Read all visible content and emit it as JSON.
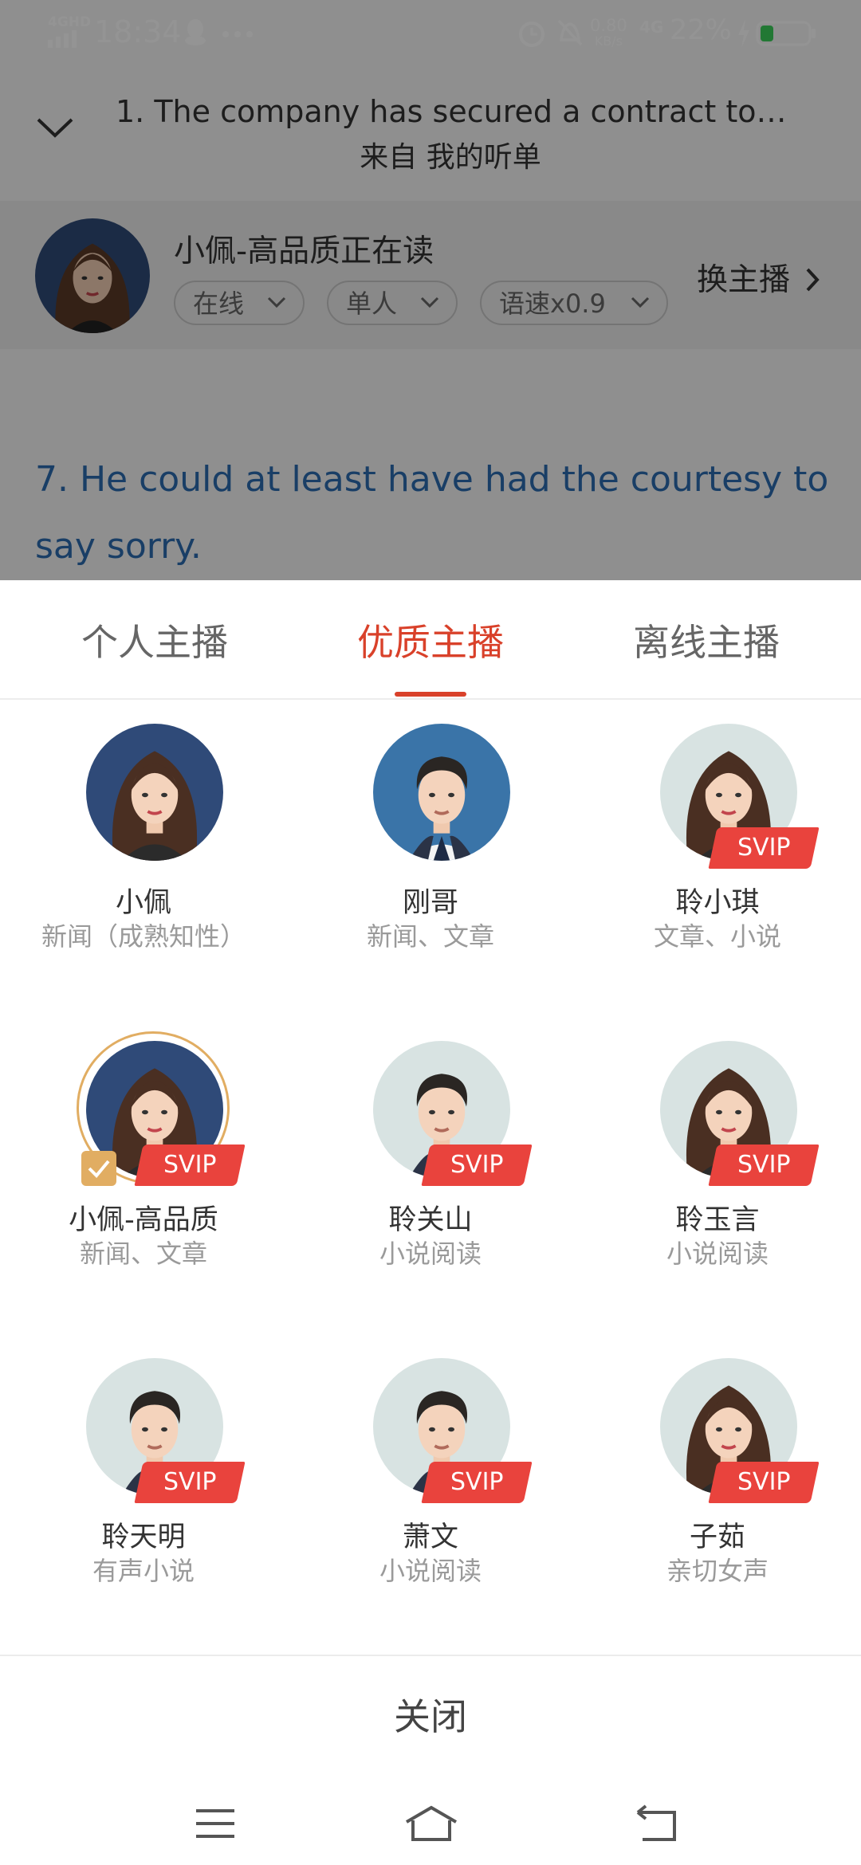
{
  "status_bar": {
    "network_label": "4GHD",
    "time": "18:34",
    "speed_value": "0.80",
    "speed_unit": "KB/s",
    "network_type": "4G",
    "battery": "22%",
    "icons": [
      "signal-icon",
      "qq-icon",
      "more-dots-icon",
      "alarm-icon",
      "mute-icon",
      "charging-icon",
      "battery-icon"
    ]
  },
  "header": {
    "title": "1. The company has secured a contract to b…",
    "source": "来自 我的听单"
  },
  "current_anchor": {
    "name": "小佩-高品质正在读",
    "options": [
      "在线",
      "单人",
      "语速x0.9"
    ],
    "switch_label": "换主播"
  },
  "reading_text": "7. He could at least have had the courtesy to say sorry.",
  "tabs": [
    "个人主播",
    "优质主播",
    "离线主播"
  ],
  "active_tab": 1,
  "badge_text": "SVIP",
  "anchors": [
    {
      "name": "小佩",
      "desc": "新闻（成熟知性）",
      "svip": false,
      "selected": false,
      "gender": "female",
      "bg": "#2f4a78"
    },
    {
      "name": "刚哥",
      "desc": "新闻、文章",
      "svip": false,
      "selected": false,
      "gender": "male",
      "bg": "#3a74a8"
    },
    {
      "name": "聆小琪",
      "desc": "文章、小说",
      "svip": true,
      "selected": false,
      "gender": "female",
      "bg": "#d8e3e2"
    },
    {
      "name": "小佩-高品质",
      "desc": "新闻、文章",
      "svip": true,
      "selected": true,
      "gender": "female",
      "bg": "#2f4a78"
    },
    {
      "name": "聆关山",
      "desc": "小说阅读",
      "svip": true,
      "selected": false,
      "gender": "male",
      "bg": "#d8e3e2"
    },
    {
      "name": "聆玉言",
      "desc": "小说阅读",
      "svip": true,
      "selected": false,
      "gender": "female",
      "bg": "#d8e3e2"
    },
    {
      "name": "聆天明",
      "desc": "有声小说",
      "svip": true,
      "selected": false,
      "gender": "male",
      "bg": "#d8e3e2"
    },
    {
      "name": "萧文",
      "desc": "小说阅读",
      "svip": true,
      "selected": false,
      "gender": "male",
      "bg": "#d8e3e2"
    },
    {
      "name": "子茹",
      "desc": "亲切女声",
      "svip": true,
      "selected": false,
      "gender": "female",
      "bg": "#d8e3e2"
    }
  ],
  "close_label": "关闭",
  "nav_icons": [
    "menu-icon",
    "home-icon",
    "back-icon"
  ],
  "colors": {
    "accent": "#d9412a",
    "svip": "#e9433d",
    "selected": "#e1ad62",
    "link_text": "#2b6cb0"
  }
}
